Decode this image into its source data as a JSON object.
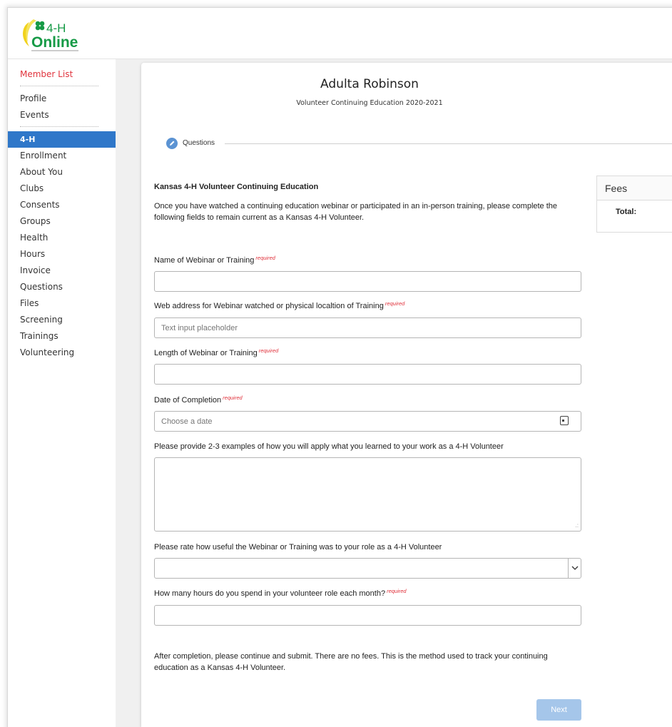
{
  "logo": {
    "line1": "4-H",
    "line2": "Online"
  },
  "sidebar": {
    "member_list": "Member List",
    "top_items": [
      "Profile",
      "Events"
    ],
    "active": "4-H",
    "items": [
      "Enrollment",
      "About You",
      "Clubs",
      "Consents",
      "Groups",
      "Health",
      "Hours",
      "Invoice",
      "Questions",
      "Files",
      "Screening",
      "Trainings",
      "Volunteering"
    ]
  },
  "header": {
    "name": "Adulta Robinson",
    "subtitle": "Volunteer Continuing Education 2020-2021"
  },
  "stepper": {
    "step_label": "Questions"
  },
  "form": {
    "heading": "Kansas 4-H Volunteer Continuing Education",
    "intro": "Once you have watched a continuing education webinar or participated in an in-person training, please complete the following fields to remain current as a Kansas 4-H Volunteer.",
    "required_text": "required",
    "fields": [
      {
        "label": "Name of Webinar or Training",
        "required": true,
        "type": "text",
        "placeholder": ""
      },
      {
        "label": "Web address for Webinar watched or physical localtion of Training",
        "required": true,
        "type": "text",
        "placeholder": "Text input placeholder"
      },
      {
        "label": "Length of Webinar or Training",
        "required": true,
        "type": "text",
        "placeholder": ""
      },
      {
        "label": "Date of Completion",
        "required": true,
        "type": "date",
        "placeholder": "Choose a date"
      },
      {
        "label": "Please provide 2-3 examples of how you will apply what you learned to your work as a 4-H Volunteer",
        "required": false,
        "type": "textarea",
        "placeholder": ""
      },
      {
        "label": "Please rate how useful the Webinar or Training was to your role as a 4-H Volunteer",
        "required": false,
        "type": "select",
        "placeholder": ""
      },
      {
        "label": "How many hours do you spend in your volunteer role each month?",
        "required": true,
        "type": "text",
        "placeholder": ""
      }
    ],
    "outro": "After completion, please continue and submit.  There are no fees.  This is the method used to track your continuing education as a Kansas 4-H Volunteer.",
    "next_label": "Next"
  },
  "fees": {
    "title": "Fees",
    "total_label": "Total:"
  },
  "colors": {
    "accent": "#2f77c9",
    "required": "#e0303a",
    "member_list": "#e0333d",
    "next_button": "#a5c6ea"
  }
}
